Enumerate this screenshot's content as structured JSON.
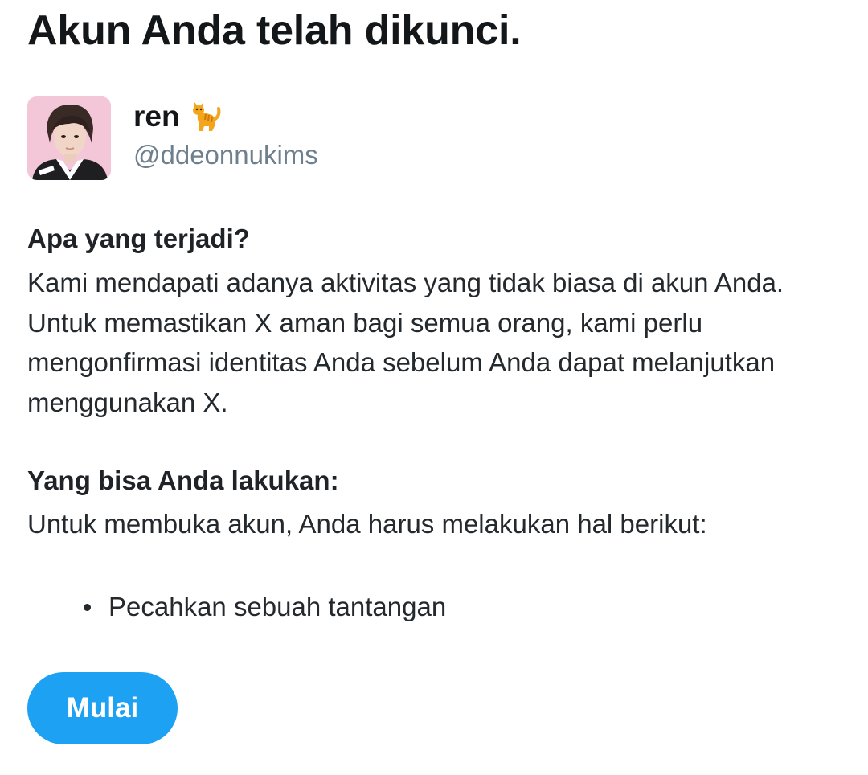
{
  "page": {
    "title": "Akun Anda telah dikunci."
  },
  "account": {
    "display_name": "ren",
    "name_emoji_icon": "cat-icon",
    "handle": "@ddeonnukims"
  },
  "what_happened": {
    "heading": "Apa yang terjadi?",
    "body": "Kami mendapati adanya aktivitas yang tidak biasa di akun Anda. Untuk memastikan X aman bagi semua orang, kami perlu mengonfirmasi identitas Anda sebelum Anda dapat melanjutkan menggunakan X."
  },
  "what_you_can_do": {
    "heading": "Yang bisa Anda lakukan:",
    "body": "Untuk membuka akun, Anda harus melakukan hal berikut:",
    "steps": [
      "Pecahkan sebuah tantangan"
    ]
  },
  "actions": {
    "start_label": "Mulai"
  },
  "colors": {
    "button_bg": "#1da1f2",
    "handle_text": "#6e7f8e",
    "avatar_bg": "#f3c7d8"
  }
}
